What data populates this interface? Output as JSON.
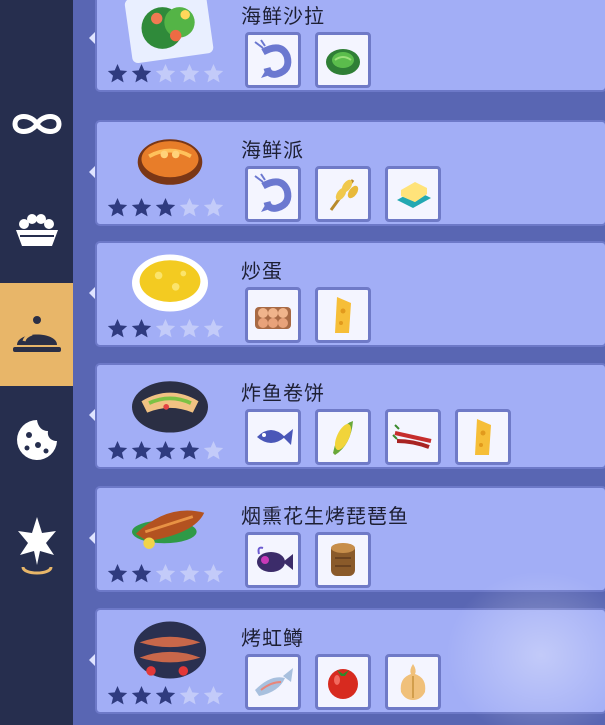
{
  "sidebar": {
    "tabs": [
      {
        "name": "infinity-icon",
        "active": false
      },
      {
        "name": "food-bowl-icon",
        "active": false
      },
      {
        "name": "cloche-icon",
        "active": true
      },
      {
        "name": "cookie-icon",
        "active": false
      },
      {
        "name": "compass-star-icon",
        "active": false
      }
    ]
  },
  "recipes": [
    {
      "name": "海鲜沙拉",
      "stars": 2,
      "max_stars": 5,
      "dish_icon": "seafood-salad-icon",
      "ingredients": [
        "shrimp-icon",
        "lettuce-icon"
      ]
    },
    {
      "name": "海鲜派",
      "stars": 3,
      "max_stars": 5,
      "dish_icon": "seafood-pie-icon",
      "ingredients": [
        "shrimp-icon",
        "wheat-icon",
        "butter-icon"
      ]
    },
    {
      "name": "炒蛋",
      "stars": 2,
      "max_stars": 5,
      "dish_icon": "scrambled-egg-icon",
      "ingredients": [
        "eggs-icon",
        "cheese-icon"
      ]
    },
    {
      "name": "炸鱼卷饼",
      "stars": 4,
      "max_stars": 5,
      "dish_icon": "fish-wrap-icon",
      "ingredients": [
        "fish-icon",
        "corn-icon",
        "chili-icon",
        "cheese-icon"
      ]
    },
    {
      "name": "烟熏花生烤琵琶鱼",
      "stars": 2,
      "max_stars": 5,
      "dish_icon": "grilled-monkfish-icon",
      "ingredients": [
        "monkfish-icon",
        "peanut-icon"
      ]
    },
    {
      "name": "烤虹鳟",
      "stars": 3,
      "max_stars": 5,
      "dish_icon": "grilled-trout-icon",
      "ingredients": [
        "trout-icon",
        "tomato-icon",
        "onion-icon"
      ]
    }
  ],
  "colors": {
    "star_filled": "#2f3b7f",
    "star_empty": "#c3cbf9",
    "active_tab": "#e8b669",
    "card": "#a2aef6"
  }
}
